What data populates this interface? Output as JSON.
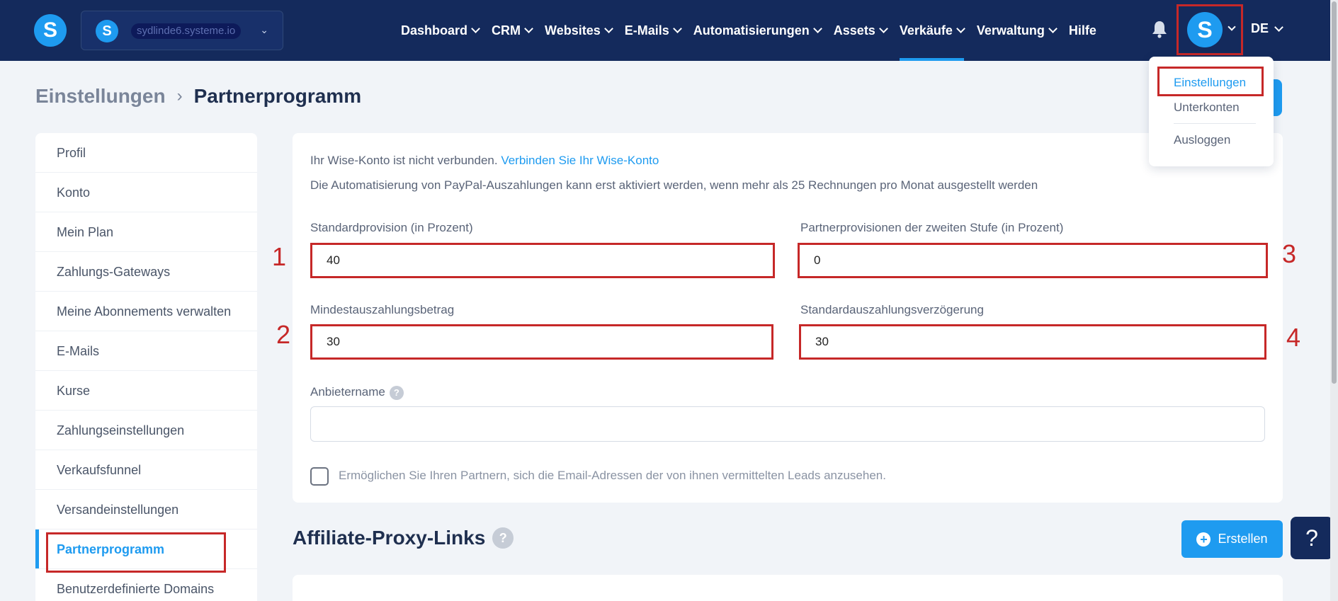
{
  "topbar": {
    "logo_letter": "S",
    "account_name": "sydlinde6.systeme.io",
    "nav": [
      {
        "label": "Dashboard",
        "caret": true
      },
      {
        "label": "CRM",
        "caret": true
      },
      {
        "label": "Websites",
        "caret": true
      },
      {
        "label": "E-Mails",
        "caret": true
      },
      {
        "label": "Automatisierungen",
        "caret": true
      },
      {
        "label": "Assets",
        "caret": true
      },
      {
        "label": "Verkäufe",
        "caret": true,
        "active": true
      },
      {
        "label": "Verwaltung",
        "caret": true
      },
      {
        "label": "Hilfe",
        "caret": false
      }
    ],
    "avatar_letter": "S",
    "language": "DE"
  },
  "user_menu": {
    "items": [
      "Einstellungen",
      "Unterkonten",
      "Ausloggen"
    ]
  },
  "breadcrumb": {
    "parent": "Einstellungen",
    "current": "Partnerprogramm"
  },
  "sidebar": {
    "items": [
      "Profil",
      "Konto",
      "Mein Plan",
      "Zahlungs-Gateways",
      "Meine Abonnements verwalten",
      "E-Mails",
      "Kurse",
      "Zahlungseinstellungen",
      "Verkaufsfunnel",
      "Versandeinstellungen",
      "Partnerprogramm",
      "Benutzerdefinierte Domains"
    ],
    "active_index": 10
  },
  "settings": {
    "wise_note": "Ihr Wise-Konto ist nicht verbunden.",
    "wise_link": "Verbinden Sie Ihr Wise-Konto",
    "paypal_note": "Die Automatisierung von PayPal-Auszahlungen kann erst aktiviert werden, wenn mehr als 25 Rechnungen pro Monat ausgestellt werden",
    "fields": {
      "standard_commission": {
        "label": "Standardprovision (in Prozent)",
        "value": "40"
      },
      "second_tier": {
        "label": "Partnerprovisionen der zweiten Stufe (in Prozent)",
        "value": "0"
      },
      "min_payout": {
        "label": "Mindestauszahlungsbetrag",
        "value": "30"
      },
      "payout_delay": {
        "label": "Standardauszahlungsverzögerung",
        "value": "30"
      },
      "provider_name": {
        "label": "Anbietername",
        "value": ""
      }
    },
    "checkbox_label": "Ermöglichen Sie Ihren Partnern, sich die Email-Adressen der von ihnen vermittelten Leads anzusehen.",
    "checkbox_checked": false
  },
  "annotations": [
    "1",
    "2",
    "3",
    "4"
  ],
  "affiliate": {
    "title": "Affiliate-Proxy-Links",
    "create_label": "Erstellen"
  },
  "help_label": "?",
  "colors": {
    "topbar": "#142a5c",
    "accent": "#1e9bf0",
    "highlight": "#c62828"
  }
}
